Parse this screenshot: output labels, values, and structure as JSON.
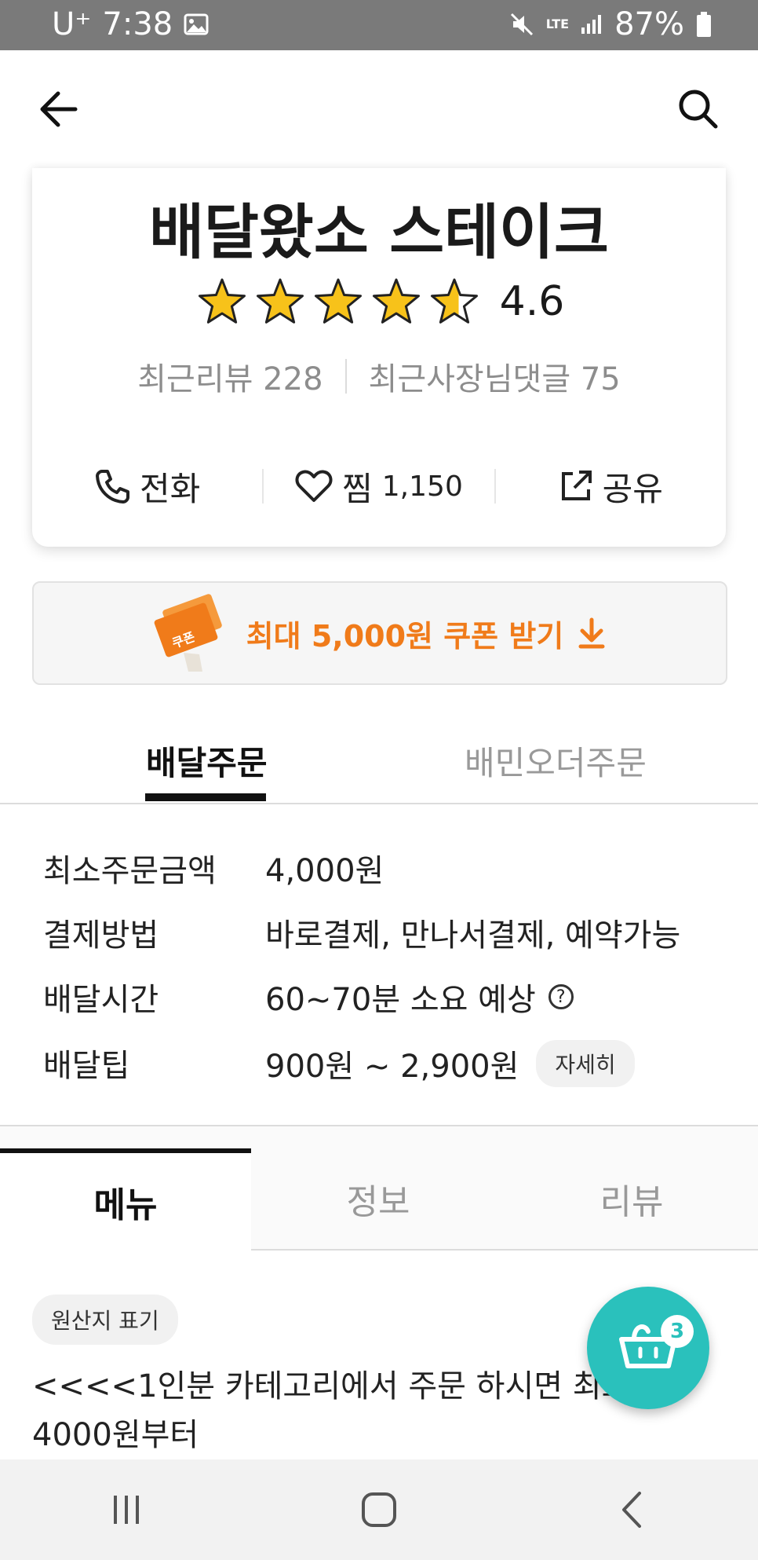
{
  "status_bar": {
    "carrier": "U⁺",
    "time": "7:38",
    "network": "LTE",
    "battery": "87%"
  },
  "store": {
    "name": "배달왔소 스테이크",
    "rating": "4.6",
    "rating_value": 4.6,
    "recent_reviews": "최근리뷰 228",
    "owner_replies": "최근사장님댓글 75"
  },
  "actions": {
    "call_label": "전화",
    "like_label": "찜",
    "like_count": "1,150",
    "share_label": "공유"
  },
  "coupon": {
    "label": "최대 5,000원 쿠폰 받기",
    "badge": "쿠폰"
  },
  "order_tabs": {
    "delivery": "배달주문",
    "bmin_order": "배민오더주문"
  },
  "info": {
    "min_order_label": "최소주문금액",
    "min_order_value": "4,000원",
    "payment_label": "결제방법",
    "payment_value": "바로결제, 만나서결제, 예약가능",
    "delivery_time_label": "배달시간",
    "delivery_time_value": "60~70분 소요 예상",
    "delivery_tip_label": "배달팁",
    "delivery_tip_value": "900원 ~ 2,900원",
    "detail_button": "자세히"
  },
  "menu_tabs": {
    "menu": "메뉴",
    "info": "정보",
    "review": "리뷰"
  },
  "origin_label": "원산지 표기",
  "notice_line1": "<<<<1인분 카테고리에서 주문 하시면 최소",
  "notice_line2": "4000원부터",
  "cart": {
    "count": "3"
  },
  "colors": {
    "accent_orange": "#f07b1a",
    "baemin_mint": "#2ac1bc",
    "star_yellow": "#f7c21a"
  }
}
